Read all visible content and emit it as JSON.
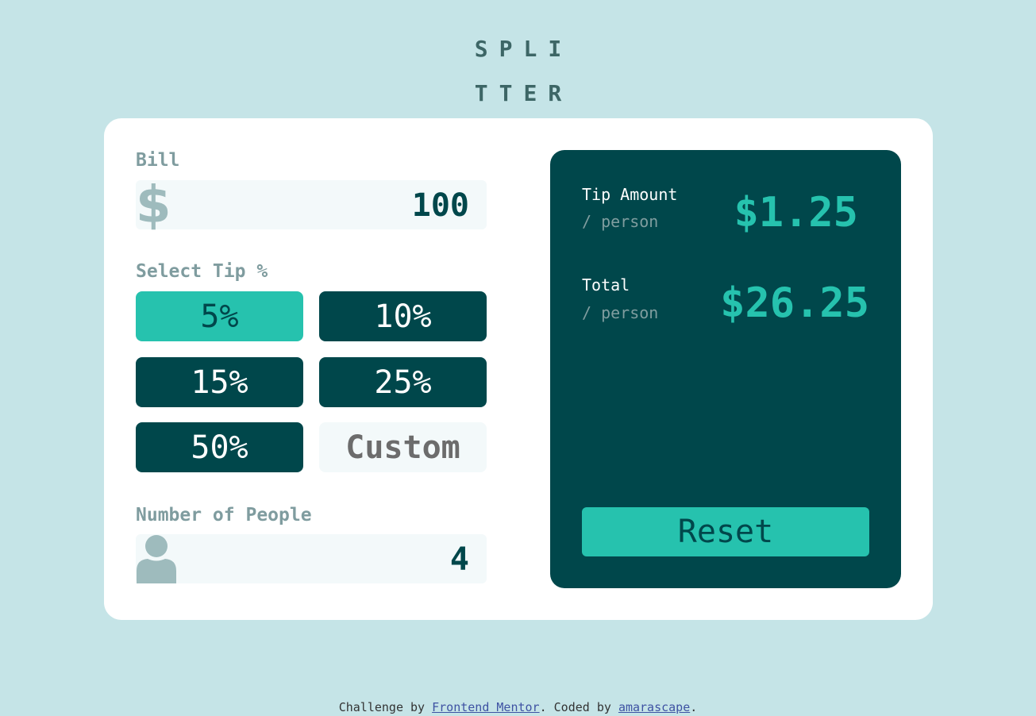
{
  "logo": {
    "line1": "SPLI",
    "line2": "TTER"
  },
  "bill": {
    "label": "Bill",
    "value": "100"
  },
  "tip": {
    "label": "Select Tip %",
    "options": [
      {
        "label": "5%",
        "active": true
      },
      {
        "label": "10%",
        "active": false
      },
      {
        "label": "15%",
        "active": false
      },
      {
        "label": "25%",
        "active": false
      },
      {
        "label": "50%",
        "active": false
      }
    ],
    "custom_label": "Custom"
  },
  "people": {
    "label": "Number of People",
    "value": "4"
  },
  "results": {
    "tip_title": "Tip Amount",
    "tip_sub": "/ person",
    "tip_value": "$1.25",
    "total_title": "Total",
    "total_sub": "/ person",
    "total_value": "$26.25",
    "reset_label": "Reset"
  },
  "footer": {
    "prefix": "Challenge by ",
    "link1": "Frontend Mentor",
    "middle": ". Coded by ",
    "link2": "amarascape",
    "suffix": "."
  },
  "colors": {
    "background": "#c5e4e7",
    "dark_cyan": "#00474b",
    "accent": "#26c2ae"
  },
  "icons": {
    "bill": "dollar-icon",
    "people": "person-icon"
  }
}
